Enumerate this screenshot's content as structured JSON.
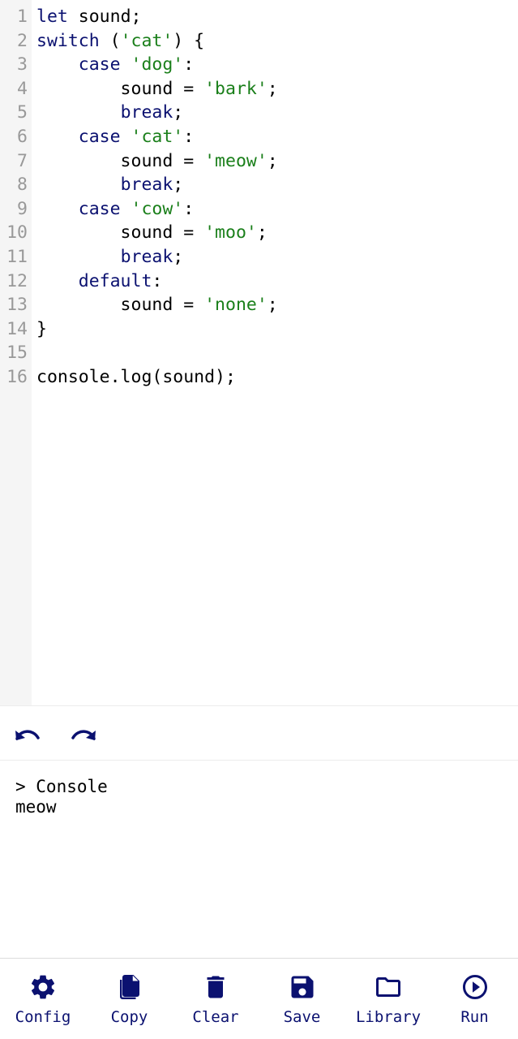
{
  "editor": {
    "lines": [
      {
        "n": "1",
        "tokens": [
          {
            "t": "let",
            "k": "kw"
          },
          {
            "t": " sound;",
            "k": "plain"
          }
        ]
      },
      {
        "n": "2",
        "tokens": [
          {
            "t": "switch",
            "k": "kw"
          },
          {
            "t": " (",
            "k": "plain"
          },
          {
            "t": "'cat'",
            "k": "str"
          },
          {
            "t": ") {",
            "k": "plain"
          }
        ]
      },
      {
        "n": "3",
        "tokens": [
          {
            "t": "    ",
            "k": "plain"
          },
          {
            "t": "case",
            "k": "kw"
          },
          {
            "t": " ",
            "k": "plain"
          },
          {
            "t": "'dog'",
            "k": "str"
          },
          {
            "t": ":",
            "k": "plain"
          }
        ]
      },
      {
        "n": "4",
        "tokens": [
          {
            "t": "        sound = ",
            "k": "plain"
          },
          {
            "t": "'bark'",
            "k": "str"
          },
          {
            "t": ";",
            "k": "plain"
          }
        ]
      },
      {
        "n": "5",
        "tokens": [
          {
            "t": "        ",
            "k": "plain"
          },
          {
            "t": "break",
            "k": "kw"
          },
          {
            "t": ";",
            "k": "plain"
          }
        ]
      },
      {
        "n": "6",
        "tokens": [
          {
            "t": "    ",
            "k": "plain"
          },
          {
            "t": "case",
            "k": "kw"
          },
          {
            "t": " ",
            "k": "plain"
          },
          {
            "t": "'cat'",
            "k": "str"
          },
          {
            "t": ":",
            "k": "plain"
          }
        ]
      },
      {
        "n": "7",
        "tokens": [
          {
            "t": "        sound = ",
            "k": "plain"
          },
          {
            "t": "'meow'",
            "k": "str"
          },
          {
            "t": ";",
            "k": "plain"
          }
        ]
      },
      {
        "n": "8",
        "tokens": [
          {
            "t": "        ",
            "k": "plain"
          },
          {
            "t": "break",
            "k": "kw"
          },
          {
            "t": ";",
            "k": "plain"
          }
        ]
      },
      {
        "n": "9",
        "tokens": [
          {
            "t": "    ",
            "k": "plain"
          },
          {
            "t": "case",
            "k": "kw"
          },
          {
            "t": " ",
            "k": "plain"
          },
          {
            "t": "'cow'",
            "k": "str"
          },
          {
            "t": ":",
            "k": "plain"
          }
        ]
      },
      {
        "n": "10",
        "tokens": [
          {
            "t": "        sound = ",
            "k": "plain"
          },
          {
            "t": "'moo'",
            "k": "str"
          },
          {
            "t": ";",
            "k": "plain"
          }
        ]
      },
      {
        "n": "11",
        "tokens": [
          {
            "t": "        ",
            "k": "plain"
          },
          {
            "t": "break",
            "k": "kw"
          },
          {
            "t": ";",
            "k": "plain"
          }
        ]
      },
      {
        "n": "12",
        "tokens": [
          {
            "t": "    ",
            "k": "plain"
          },
          {
            "t": "default",
            "k": "kw"
          },
          {
            "t": ":",
            "k": "plain"
          }
        ]
      },
      {
        "n": "13",
        "tokens": [
          {
            "t": "        sound = ",
            "k": "plain"
          },
          {
            "t": "'none'",
            "k": "str"
          },
          {
            "t": ";",
            "k": "plain"
          }
        ]
      },
      {
        "n": "14",
        "tokens": [
          {
            "t": "}",
            "k": "plain"
          }
        ]
      },
      {
        "n": "15",
        "tokens": []
      },
      {
        "n": "16",
        "tokens": [
          {
            "t": "console.log(sound);",
            "k": "plain"
          }
        ]
      }
    ]
  },
  "history": {
    "undo_icon": "undo-icon",
    "redo_icon": "redo-icon"
  },
  "console": {
    "title": "> Console",
    "output": "meow"
  },
  "toolbar": {
    "items": [
      {
        "label": "Config",
        "icon": "gear-icon"
      },
      {
        "label": "Copy",
        "icon": "copy-icon"
      },
      {
        "label": "Clear",
        "icon": "trash-icon"
      },
      {
        "label": "Save",
        "icon": "floppy-disk-icon"
      },
      {
        "label": "Library",
        "icon": "folder-icon"
      },
      {
        "label": "Run",
        "icon": "play-circle-icon"
      }
    ]
  },
  "colors": {
    "accent": "#0b1170",
    "keyword": "#0b1170",
    "string": "#1a7f1a",
    "gutter_bg": "#f5f5f5",
    "line_number": "#999999"
  }
}
